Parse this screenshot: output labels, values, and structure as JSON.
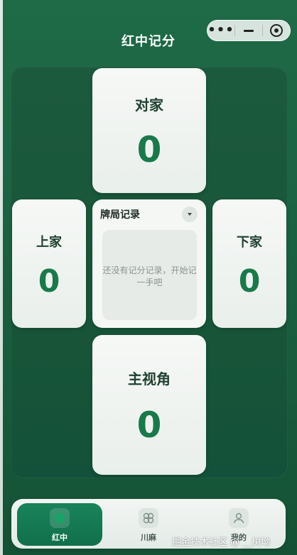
{
  "header": {
    "title": "红中记分"
  },
  "capsule": {
    "more_glyph": "•••",
    "minimize_icon": "minus-icon",
    "close_icon": "target-icon"
  },
  "players": {
    "top": {
      "name": "对家",
      "score": "0"
    },
    "left": {
      "name": "上家",
      "score": "0"
    },
    "right": {
      "name": "下家",
      "score": "0"
    },
    "bottom": {
      "name": "主视角",
      "score": "0"
    }
  },
  "records": {
    "title": "牌局记录",
    "empty_text": "还没有记分记录，开始记一手吧"
  },
  "tabs": [
    {
      "label": "红中",
      "icon": "hongzhong-icon",
      "active": true
    },
    {
      "label": "川麻",
      "icon": "chuanma-icon",
      "active": false
    },
    {
      "label": "我的",
      "icon": "user-icon",
      "active": false
    }
  ],
  "watermark": "掘金技术社区 @ __树坳",
  "colors": {
    "accent": "#19794b",
    "background": "#1a6141",
    "active_tab": "#11704c"
  }
}
